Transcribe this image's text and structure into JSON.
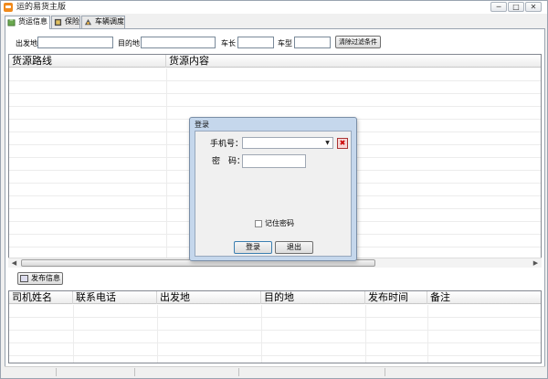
{
  "window": {
    "title": "运的易货主版",
    "minimize_glyph": "─",
    "maximize_glyph": "□",
    "close_glyph": "✕"
  },
  "tabs": [
    {
      "label": "货运信息",
      "icon": "cargo-icon",
      "active": true
    },
    {
      "label": "保险",
      "icon": "insurance-icon",
      "active": false
    },
    {
      "label": "车辆调度",
      "icon": "vehicle-dispatch-icon",
      "active": false
    }
  ],
  "filters": {
    "origin_label": "出发地",
    "origin_value": "",
    "destination_label": "目的地",
    "destination_value": "",
    "vehicle_length_label": "车长",
    "vehicle_length_value": "",
    "vehicle_type_label": "车型",
    "vehicle_type_value": "",
    "clear_button": "清除过滤条件"
  },
  "cargo_grid": {
    "columns": [
      "货源路线",
      "货源内容"
    ],
    "rows": []
  },
  "publish_button": "发布信息",
  "driver_grid": {
    "columns": [
      "司机姓名",
      "联系电话",
      "出发地",
      "目的地",
      "发布时间",
      "备注"
    ],
    "rows": []
  },
  "login_dialog": {
    "title": "登录",
    "phone_label": "手机号：",
    "phone_value": "",
    "password_label": "密　码：",
    "password_value": "",
    "remember_label": "记住密码",
    "remember_checked": false,
    "login_button": "登录",
    "exit_button": "退出",
    "delete_glyph": "✖",
    "dropdown_glyph": "▼"
  },
  "colors": {
    "accent": "#3c7fb1",
    "dialog_frame": "#c5d7ec",
    "app_icon": "#f08a1c"
  }
}
